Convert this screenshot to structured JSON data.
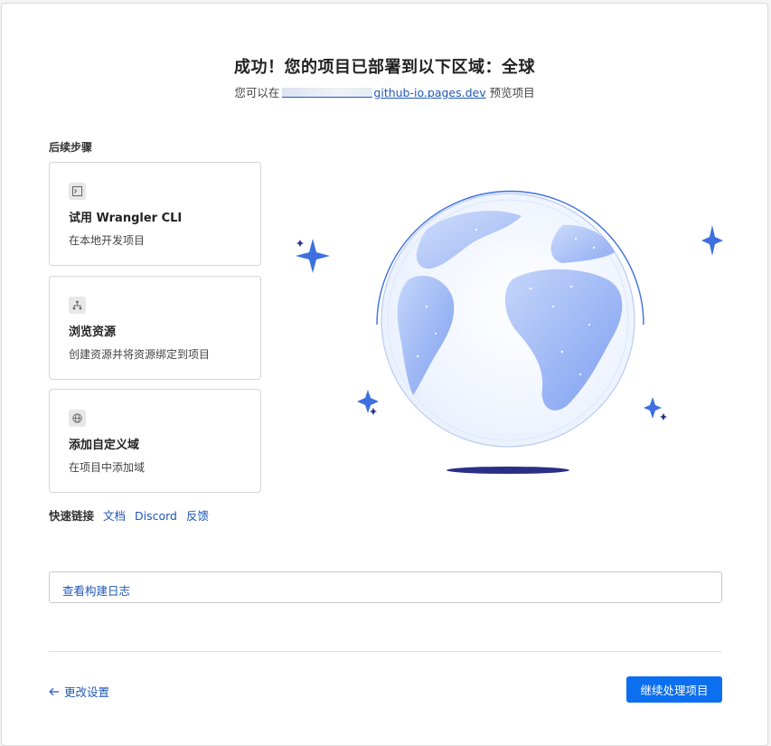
{
  "header": {
    "title": "成功！您的项目已部署到以下区域：全球",
    "sub_prefix": "您可以在",
    "sub_link": "github-io.pages.dev",
    "sub_suffix": " 预览项目"
  },
  "next_steps": {
    "label": "后续步骤",
    "cards": [
      {
        "icon": "terminal-icon",
        "title": "试用 Wrangler CLI",
        "desc": "在本地开发项目"
      },
      {
        "icon": "sitemap-icon",
        "title": "浏览资源",
        "desc": "创建资源并将资源绑定到项目"
      },
      {
        "icon": "globe-icon",
        "title": "添加自定义域",
        "desc": "在项目中添加域"
      }
    ]
  },
  "quick_links": {
    "label": "快速链接",
    "links": [
      "文档",
      "Discord",
      "反馈"
    ]
  },
  "build_log_label": "查看构建日志",
  "footer": {
    "back_label": "更改设置",
    "continue_label": "继续处理项目"
  },
  "colors": {
    "accent": "#0b6ff0",
    "link": "#1f57b8",
    "globe_dark": "#2a2f85",
    "globe_light": "#9bb8f5"
  }
}
